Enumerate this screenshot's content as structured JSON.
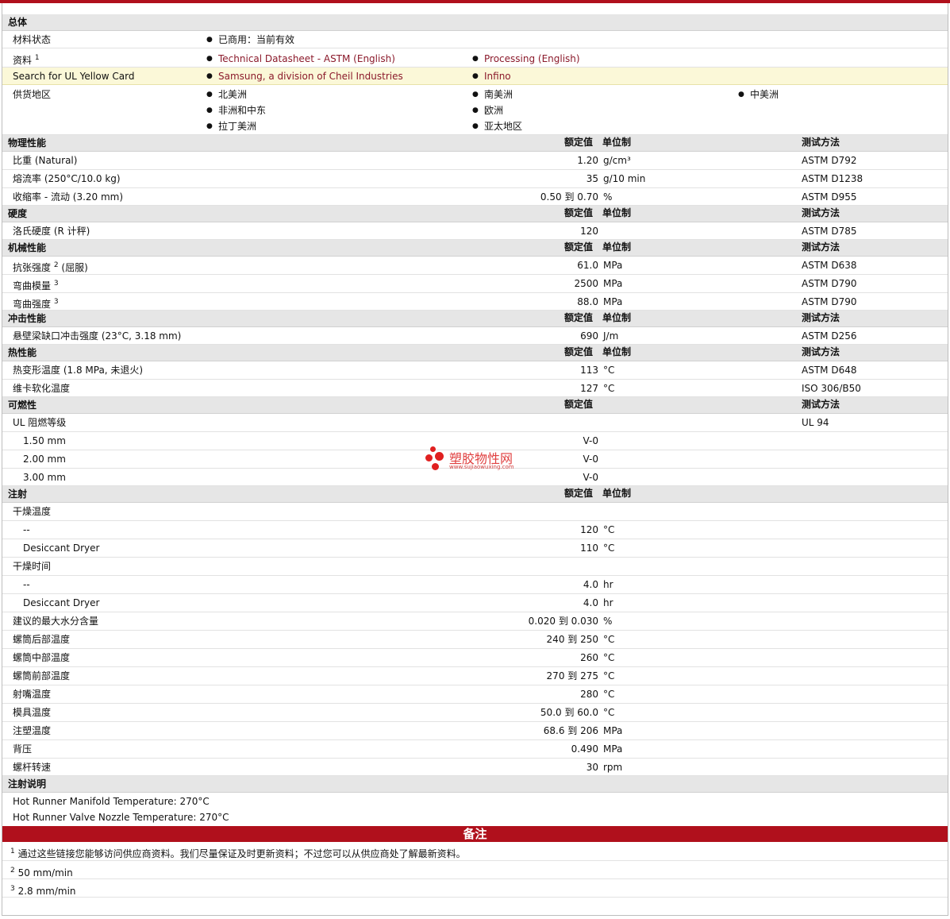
{
  "general": {
    "title": "总体",
    "material_status_label": "材料状态",
    "material_status_value": "已商用：当前有效",
    "docs_label": "资料",
    "docs_sup": "1",
    "docs_link1": "Technical Datasheet - ASTM (English)",
    "docs_link2": "Processing (English)",
    "ul_label": "Search for UL Yellow Card",
    "ul_link1": "Samsung, a division of Cheil Industries",
    "ul_link2": "Infino",
    "region_label": "供货地区",
    "regions": [
      "北美洲",
      "南美洲",
      "中美洲",
      "非洲和中东",
      "欧洲",
      "拉丁美洲",
      "亚太地区"
    ]
  },
  "headers": {
    "nominal": "额定值",
    "unit": "单位制",
    "method": "测试方法"
  },
  "physical": {
    "title": "物理性能",
    "rows": [
      {
        "label": "比重  (Natural)",
        "value": "1.20",
        "unit": "g/cm³",
        "method": "ASTM D792"
      },
      {
        "label": "熔流率  (250°C/10.0 kg)",
        "value": "35",
        "unit": "g/10 min",
        "method": "ASTM D1238"
      },
      {
        "label": "收缩率  - 流动  (3.20 mm)",
        "value": "0.50 到  0.70",
        "unit": "%",
        "method": "ASTM D955"
      }
    ]
  },
  "hardness": {
    "title": "硬度",
    "rows": [
      {
        "label": "洛氏硬度  (R 计秤)",
        "value": "120",
        "unit": "",
        "method": "ASTM D785"
      }
    ]
  },
  "mechanical": {
    "title": "机械性能",
    "rows": [
      {
        "label": "抗张强度",
        "sup": "2",
        "suffix": " (屈服)",
        "value": "61.0",
        "unit": "MPa",
        "method": "ASTM D638"
      },
      {
        "label": "弯曲模量",
        "sup": "3",
        "suffix": "",
        "value": "2500",
        "unit": "MPa",
        "method": "ASTM D790"
      },
      {
        "label": "弯曲强度",
        "sup": "3",
        "suffix": "",
        "value": "88.0",
        "unit": "MPa",
        "method": "ASTM D790"
      }
    ]
  },
  "impact": {
    "title": "冲击性能",
    "rows": [
      {
        "label": "悬壁梁缺口冲击强度  (23°C, 3.18 mm)",
        "value": "690",
        "unit": "J/m",
        "method": "ASTM D256"
      }
    ]
  },
  "thermal": {
    "title": "热性能",
    "rows": [
      {
        "label": "热变形温度  (1.8 MPa, 未退火)",
        "value": "113",
        "unit": "°C",
        "method": "ASTM D648"
      },
      {
        "label": "维卡软化温度",
        "value": "127",
        "unit": "°C",
        "method": "ISO 306/B50"
      }
    ]
  },
  "flammability": {
    "title": "可燃性",
    "ul_label": "UL 阻燃等级",
    "ul_method": "UL 94",
    "rows": [
      {
        "label": "1.50 mm",
        "value": "V-0"
      },
      {
        "label": "2.00 mm",
        "value": "V-0"
      },
      {
        "label": "3.00 mm",
        "value": "V-0"
      }
    ]
  },
  "injection": {
    "title": "注射",
    "drying_temp_label": "干燥温度",
    "drying_time_label": "干燥时间",
    "drying_temp_rows": [
      {
        "label": "--",
        "value": "120",
        "unit": "°C"
      },
      {
        "label": "Desiccant Dryer",
        "value": "110",
        "unit": "°C"
      }
    ],
    "drying_time_rows": [
      {
        "label": "--",
        "value": "4.0",
        "unit": "hr"
      },
      {
        "label": "Desiccant Dryer",
        "value": "4.0",
        "unit": "hr"
      }
    ],
    "rows": [
      {
        "label": "建议的最大水分含量",
        "value": "0.020 到  0.030",
        "unit": "%"
      },
      {
        "label": "螺筒后部温度",
        "value": "240 到  250",
        "unit": "°C"
      },
      {
        "label": "螺筒中部温度",
        "value": "260",
        "unit": "°C"
      },
      {
        "label": "螺筒前部温度",
        "value": "270 到  275",
        "unit": "°C"
      },
      {
        "label": "射嘴温度",
        "value": "280",
        "unit": "°C"
      },
      {
        "label": "模具温度",
        "value": "50.0 到  60.0",
        "unit": "°C"
      },
      {
        "label": "注塑温度",
        "value": "68.6 到  206",
        "unit": "MPa"
      },
      {
        "label": "背压",
        "value": "0.490",
        "unit": "MPa"
      },
      {
        "label": "螺杆转速",
        "value": "30",
        "unit": "rpm"
      }
    ]
  },
  "injection_notes": {
    "title": "注射说明",
    "lines": [
      "Hot Runner Manifold Temperature: 270°C",
      "Hot Runner Valve Nozzle Temperature: 270°C"
    ]
  },
  "notes": {
    "title": "备注",
    "items": [
      {
        "num": "1",
        "text": "通过这些链接您能够访问供应商资料。我们尽量保证及时更新资料；不过您可以从供应商处了解最新资料。"
      },
      {
        "num": "2",
        "text": "50 mm/min"
      },
      {
        "num": "3",
        "text": "2.8 mm/min"
      }
    ]
  },
  "watermark": {
    "text": "塑胶物性网",
    "url": "www.sujiaowuxing.com"
  },
  "colors": {
    "accent": "#b0101c",
    "link": "#8b1a2b",
    "header_bg": "#e6e6e6",
    "highlight_bg": "#fbf8d8"
  }
}
